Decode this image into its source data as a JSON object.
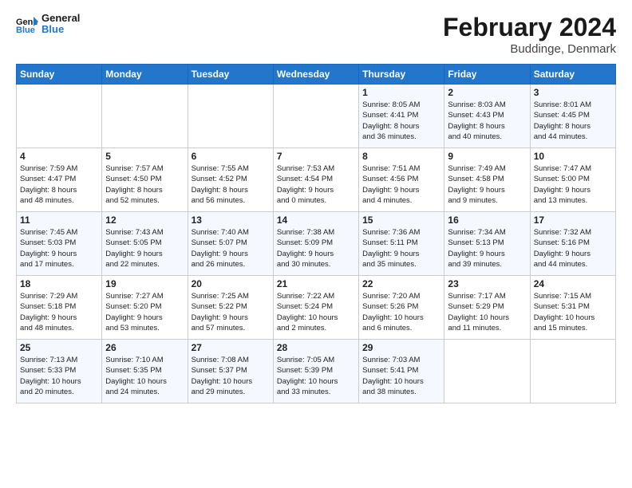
{
  "logo": {
    "line1": "General",
    "line2": "Blue"
  },
  "title": "February 2024",
  "location": "Buddinge, Denmark",
  "days_of_week": [
    "Sunday",
    "Monday",
    "Tuesday",
    "Wednesday",
    "Thursday",
    "Friday",
    "Saturday"
  ],
  "weeks": [
    [
      {
        "day": "",
        "info": ""
      },
      {
        "day": "",
        "info": ""
      },
      {
        "day": "",
        "info": ""
      },
      {
        "day": "",
        "info": ""
      },
      {
        "day": "1",
        "info": "Sunrise: 8:05 AM\nSunset: 4:41 PM\nDaylight: 8 hours\nand 36 minutes."
      },
      {
        "day": "2",
        "info": "Sunrise: 8:03 AM\nSunset: 4:43 PM\nDaylight: 8 hours\nand 40 minutes."
      },
      {
        "day": "3",
        "info": "Sunrise: 8:01 AM\nSunset: 4:45 PM\nDaylight: 8 hours\nand 44 minutes."
      }
    ],
    [
      {
        "day": "4",
        "info": "Sunrise: 7:59 AM\nSunset: 4:47 PM\nDaylight: 8 hours\nand 48 minutes."
      },
      {
        "day": "5",
        "info": "Sunrise: 7:57 AM\nSunset: 4:50 PM\nDaylight: 8 hours\nand 52 minutes."
      },
      {
        "day": "6",
        "info": "Sunrise: 7:55 AM\nSunset: 4:52 PM\nDaylight: 8 hours\nand 56 minutes."
      },
      {
        "day": "7",
        "info": "Sunrise: 7:53 AM\nSunset: 4:54 PM\nDaylight: 9 hours\nand 0 minutes."
      },
      {
        "day": "8",
        "info": "Sunrise: 7:51 AM\nSunset: 4:56 PM\nDaylight: 9 hours\nand 4 minutes."
      },
      {
        "day": "9",
        "info": "Sunrise: 7:49 AM\nSunset: 4:58 PM\nDaylight: 9 hours\nand 9 minutes."
      },
      {
        "day": "10",
        "info": "Sunrise: 7:47 AM\nSunset: 5:00 PM\nDaylight: 9 hours\nand 13 minutes."
      }
    ],
    [
      {
        "day": "11",
        "info": "Sunrise: 7:45 AM\nSunset: 5:03 PM\nDaylight: 9 hours\nand 17 minutes."
      },
      {
        "day": "12",
        "info": "Sunrise: 7:43 AM\nSunset: 5:05 PM\nDaylight: 9 hours\nand 22 minutes."
      },
      {
        "day": "13",
        "info": "Sunrise: 7:40 AM\nSunset: 5:07 PM\nDaylight: 9 hours\nand 26 minutes."
      },
      {
        "day": "14",
        "info": "Sunrise: 7:38 AM\nSunset: 5:09 PM\nDaylight: 9 hours\nand 30 minutes."
      },
      {
        "day": "15",
        "info": "Sunrise: 7:36 AM\nSunset: 5:11 PM\nDaylight: 9 hours\nand 35 minutes."
      },
      {
        "day": "16",
        "info": "Sunrise: 7:34 AM\nSunset: 5:13 PM\nDaylight: 9 hours\nand 39 minutes."
      },
      {
        "day": "17",
        "info": "Sunrise: 7:32 AM\nSunset: 5:16 PM\nDaylight: 9 hours\nand 44 minutes."
      }
    ],
    [
      {
        "day": "18",
        "info": "Sunrise: 7:29 AM\nSunset: 5:18 PM\nDaylight: 9 hours\nand 48 minutes."
      },
      {
        "day": "19",
        "info": "Sunrise: 7:27 AM\nSunset: 5:20 PM\nDaylight: 9 hours\nand 53 minutes."
      },
      {
        "day": "20",
        "info": "Sunrise: 7:25 AM\nSunset: 5:22 PM\nDaylight: 9 hours\nand 57 minutes."
      },
      {
        "day": "21",
        "info": "Sunrise: 7:22 AM\nSunset: 5:24 PM\nDaylight: 10 hours\nand 2 minutes."
      },
      {
        "day": "22",
        "info": "Sunrise: 7:20 AM\nSunset: 5:26 PM\nDaylight: 10 hours\nand 6 minutes."
      },
      {
        "day": "23",
        "info": "Sunrise: 7:17 AM\nSunset: 5:29 PM\nDaylight: 10 hours\nand 11 minutes."
      },
      {
        "day": "24",
        "info": "Sunrise: 7:15 AM\nSunset: 5:31 PM\nDaylight: 10 hours\nand 15 minutes."
      }
    ],
    [
      {
        "day": "25",
        "info": "Sunrise: 7:13 AM\nSunset: 5:33 PM\nDaylight: 10 hours\nand 20 minutes."
      },
      {
        "day": "26",
        "info": "Sunrise: 7:10 AM\nSunset: 5:35 PM\nDaylight: 10 hours\nand 24 minutes."
      },
      {
        "day": "27",
        "info": "Sunrise: 7:08 AM\nSunset: 5:37 PM\nDaylight: 10 hours\nand 29 minutes."
      },
      {
        "day": "28",
        "info": "Sunrise: 7:05 AM\nSunset: 5:39 PM\nDaylight: 10 hours\nand 33 minutes."
      },
      {
        "day": "29",
        "info": "Sunrise: 7:03 AM\nSunset: 5:41 PM\nDaylight: 10 hours\nand 38 minutes."
      },
      {
        "day": "",
        "info": ""
      },
      {
        "day": "",
        "info": ""
      }
    ]
  ]
}
